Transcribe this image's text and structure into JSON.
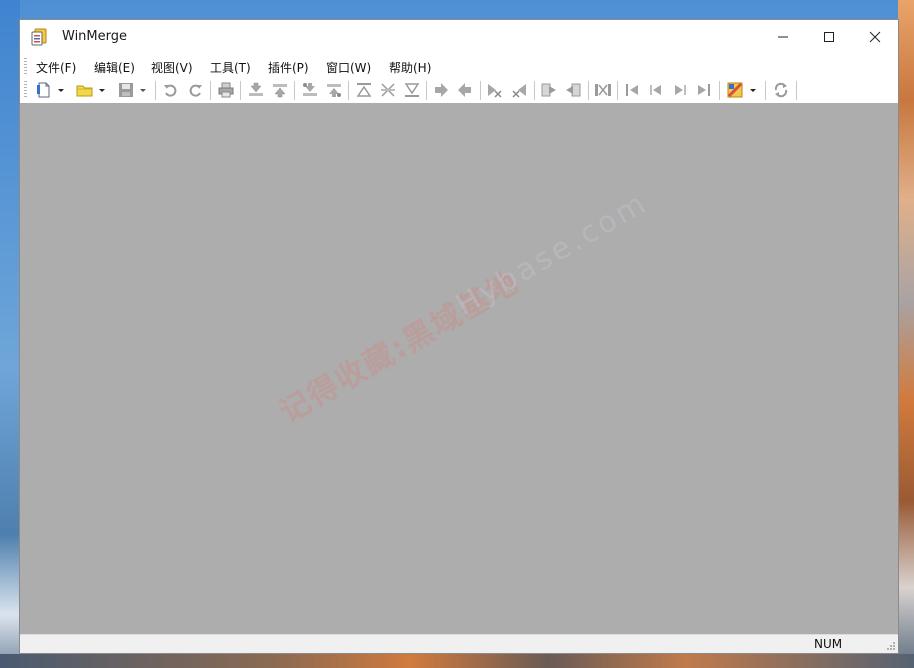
{
  "window": {
    "title": "WinMerge",
    "controls": {
      "minimize": "minimize-icon",
      "maximize": "maximize-icon",
      "close": "close-icon"
    }
  },
  "menu": {
    "items": [
      {
        "label": "文件(F)"
      },
      {
        "label": "编辑(E)"
      },
      {
        "label": "视图(V)"
      },
      {
        "label": "工具(T)"
      },
      {
        "label": "插件(P)"
      },
      {
        "label": "窗口(W)"
      },
      {
        "label": "帮助(H)"
      }
    ]
  },
  "toolbar": {
    "buttons": [
      {
        "icon": "new-document-icon"
      },
      {
        "icon": "open-folder-icon"
      },
      {
        "icon": "save-icon"
      },
      {
        "icon": "undo-icon"
      },
      {
        "icon": "redo-icon"
      },
      {
        "icon": "print-icon"
      },
      {
        "icon": "next-diff-icon"
      },
      {
        "icon": "prev-diff-icon"
      },
      {
        "icon": "next-conflict-icon"
      },
      {
        "icon": "prev-conflict-icon"
      },
      {
        "icon": "first-diff-icon"
      },
      {
        "icon": "current-diff-icon"
      },
      {
        "icon": "last-diff-icon"
      },
      {
        "icon": "copy-right-icon"
      },
      {
        "icon": "copy-left-icon"
      },
      {
        "icon": "copy-right-advance-icon"
      },
      {
        "icon": "copy-left-advance-icon"
      },
      {
        "icon": "copy-all-right-icon"
      },
      {
        "icon": "copy-all-left-icon"
      },
      {
        "icon": "merge-all-icon"
      },
      {
        "icon": "goto-first-icon"
      },
      {
        "icon": "goto-prev-icon"
      },
      {
        "icon": "goto-next-icon"
      },
      {
        "icon": "goto-last-icon"
      },
      {
        "icon": "options-icon"
      },
      {
        "icon": "refresh-icon"
      }
    ]
  },
  "client": {
    "watermark": "记得收藏:黑域基地",
    "watermark_url": "Hybase.com"
  },
  "statusbar": {
    "num": "NUM"
  },
  "colors": {
    "client_bg": "#adadad",
    "icon_yellow": "#e8c21a",
    "icon_gray": "#a7a7a7",
    "icon_blue": "#3a6fd0"
  }
}
